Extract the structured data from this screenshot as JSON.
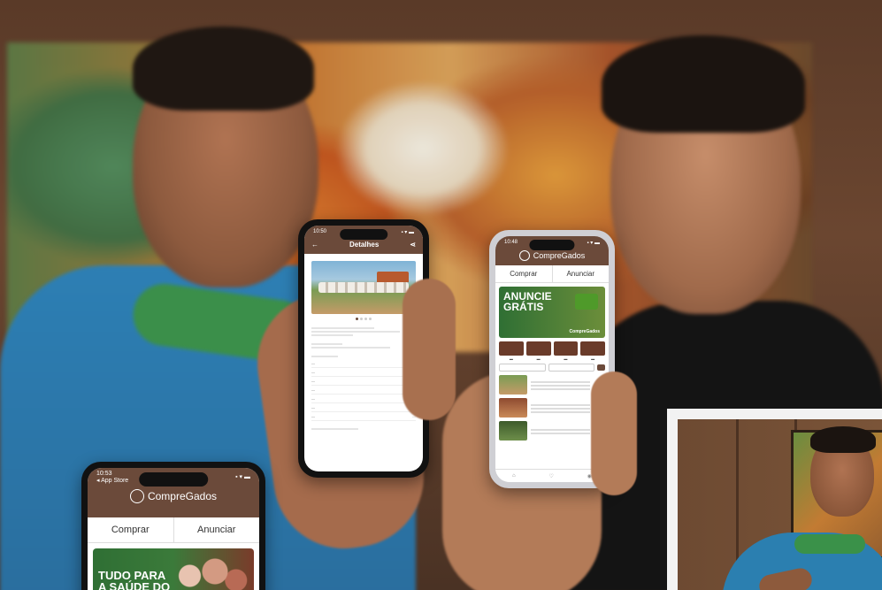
{
  "brand": "CompreGados",
  "tabs": {
    "buy": "Comprar",
    "sell": "Anunciar"
  },
  "phone_right": {
    "time": "10:48",
    "banner_title_1": "ANUNCIE",
    "banner_title_2": "GRÁTIS",
    "banner_brand": "CompreGados"
  },
  "phone_center": {
    "time": "10:50",
    "header": "Detalhes"
  },
  "phone_left": {
    "time": "10:53",
    "back_label": "◂ App Store",
    "banner_line_1": "TUDO PARA",
    "banner_line_2": "A SAÚDE DO"
  },
  "colors": {
    "brand_brown": "#6b4a3a",
    "banner_green": "#2f6f34"
  }
}
